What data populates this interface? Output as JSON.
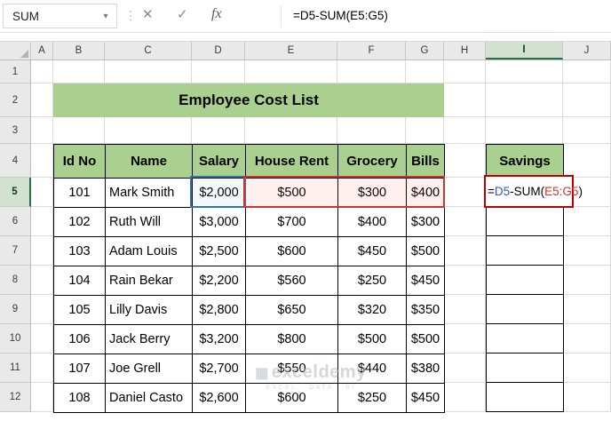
{
  "formula_bar": {
    "name_box_value": "SUM",
    "dropdown_icon": "▾",
    "separator_dots": "⋮",
    "cancel_label": "✕",
    "enter_label": "✓",
    "insert_function_label": "fx",
    "formula_text": "=D5-SUM(E5:G5)"
  },
  "sheet": {
    "column_letters": [
      "A",
      "B",
      "C",
      "D",
      "E",
      "F",
      "G",
      "H",
      "I",
      "J"
    ],
    "row_numbers": [
      "1",
      "2",
      "3",
      "4",
      "5",
      "6",
      "7",
      "8",
      "9",
      "10",
      "11",
      "12"
    ],
    "active_column": "I",
    "active_row": "5"
  },
  "title_banner": "Employee Cost List",
  "cost_table": {
    "headers": [
      "Id No",
      "Name",
      "Salary",
      "House Rent",
      "Grocery",
      "Bills"
    ],
    "rows": [
      [
        "101",
        "Mark Smith",
        "$2,000",
        "$500",
        "$300",
        "$400"
      ],
      [
        "102",
        "Ruth Will",
        "$3,000",
        "$700",
        "$400",
        "$300"
      ],
      [
        "103",
        "Adam Louis",
        "$2,500",
        "$600",
        "$450",
        "$500"
      ],
      [
        "104",
        "Rain Bekar",
        "$2,200",
        "$560",
        "$250",
        "$450"
      ],
      [
        "105",
        "Lilly Davis",
        "$2,800",
        "$650",
        "$320",
        "$350"
      ],
      [
        "106",
        "Jack Berry",
        "$3,200",
        "$800",
        "$500",
        "$500"
      ],
      [
        "107",
        "Joe Grell",
        "$2,700",
        "$550",
        "$440",
        "$380"
      ],
      [
        "108",
        "Daniel Casto",
        "$2,600",
        "$600",
        "$250",
        "$450"
      ]
    ]
  },
  "savings_column": {
    "header": "Savings",
    "formula_cell": {
      "equals": "=",
      "ref1": "D5",
      "operator": "-SUM(",
      "ref2": "E5:G5",
      "close": ")"
    }
  },
  "watermark": {
    "brand": "exceldemy",
    "tagline": "EXCEL · DATA · BI"
  },
  "colors": {
    "table_header_green": "#A9D08E",
    "active_header_tint": "#D3E2D0",
    "active_header_line": "#217346",
    "ref1_blue": "#2E75B6",
    "ref2_red": "#D0342C",
    "edit_cell_border_red": "#C00000"
  }
}
